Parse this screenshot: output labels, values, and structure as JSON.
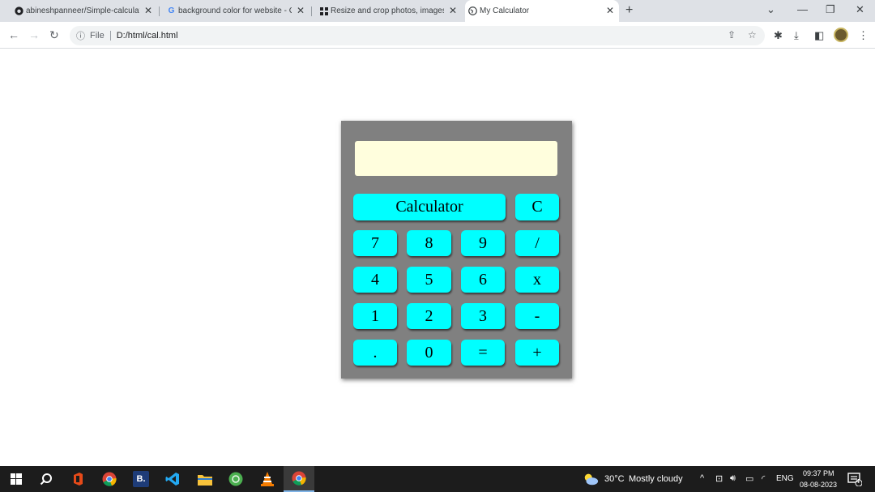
{
  "browser": {
    "tabs": [
      {
        "title": "abineshpanneer/Simple-calculato",
        "favicon": "github-icon"
      },
      {
        "title": "background color for website - G",
        "favicon": "google-icon"
      },
      {
        "title": "Resize and crop photos, images o",
        "favicon": "grid-icon"
      },
      {
        "title": "My Calculator",
        "favicon": "globe-icon"
      }
    ],
    "active_tab": 3,
    "address": {
      "scheme_label": "File",
      "url": "D:/html/cal.html"
    }
  },
  "calculator": {
    "display_value": "",
    "title_key": "Calculator",
    "keys": {
      "clear": "C",
      "seven": "7",
      "eight": "8",
      "nine": "9",
      "divide": "/",
      "four": "4",
      "five": "5",
      "six": "6",
      "multiply": "x",
      "one": "1",
      "two": "2",
      "three": "3",
      "minus": "-",
      "dot": ".",
      "zero": "0",
      "equals": "=",
      "plus": "+"
    },
    "colors": {
      "body": "#808080",
      "display": "#fffedd",
      "key": "#00ffff"
    }
  },
  "taskbar": {
    "weather": {
      "temp": "30°C",
      "condition": "Mostly cloudy"
    },
    "language": "ENG",
    "time": "09:37 PM",
    "date": "08-08-2023",
    "notification_count": "4"
  }
}
